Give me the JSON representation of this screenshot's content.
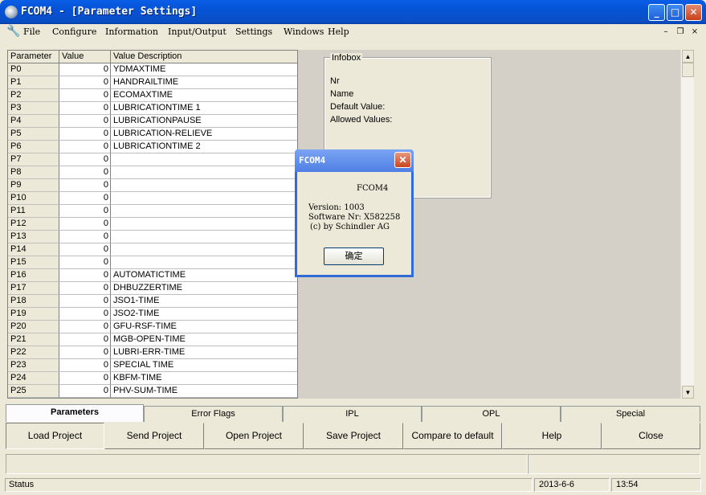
{
  "window": {
    "title": "FCOM4 - [Parameter Settings]",
    "min_glyph": "_",
    "max_glyph": "□",
    "close_glyph": "✕"
  },
  "menu": {
    "icon_glyph": "🔧",
    "items": [
      "File",
      "Configure",
      "Information",
      "Input/Output",
      "Settings",
      "Windows",
      "Help"
    ],
    "mdi_min": "–",
    "mdi_restore": "❐",
    "mdi_close": "×"
  },
  "grid": {
    "headers": [
      "Parameter",
      "Value",
      "Value Description"
    ],
    "rows": [
      [
        "P0",
        "0",
        "YDMAXTIME"
      ],
      [
        "P1",
        "0",
        "HANDRAILTIME"
      ],
      [
        "P2",
        "0",
        "ECOMAXTIME"
      ],
      [
        "P3",
        "0",
        "LUBRICATIONTIME 1"
      ],
      [
        "P4",
        "0",
        "LUBRICATIONPAUSE"
      ],
      [
        "P5",
        "0",
        "LUBRICATION-RELIEVE"
      ],
      [
        "P6",
        "0",
        "LUBRICATIONTIME 2"
      ],
      [
        "P7",
        "0",
        ""
      ],
      [
        "P8",
        "0",
        ""
      ],
      [
        "P9",
        "0",
        ""
      ],
      [
        "P10",
        "0",
        ""
      ],
      [
        "P11",
        "0",
        ""
      ],
      [
        "P12",
        "0",
        ""
      ],
      [
        "P13",
        "0",
        ""
      ],
      [
        "P14",
        "0",
        ""
      ],
      [
        "P15",
        "0",
        ""
      ],
      [
        "P16",
        "0",
        "AUTOMATICTIME"
      ],
      [
        "P17",
        "0",
        "DHBUZZERTIME"
      ],
      [
        "P18",
        "0",
        "JSO1-TIME"
      ],
      [
        "P19",
        "0",
        "JSO2-TIME"
      ],
      [
        "P20",
        "0",
        "GFU-RSF-TIME"
      ],
      [
        "P21",
        "0",
        "MGB-OPEN-TIME"
      ],
      [
        "P22",
        "0",
        "LUBRI-ERR-TIME"
      ],
      [
        "P23",
        "0",
        "SPECIAL TIME"
      ],
      [
        "P24",
        "0",
        "KBFM-TIME"
      ],
      [
        "P25",
        "0",
        "PHV-SUM-TIME"
      ]
    ]
  },
  "infobox": {
    "legend": "Infobox",
    "lines": [
      "Nr",
      "Name",
      "Default Value:",
      "Allowed Values:"
    ]
  },
  "scrollbar": {
    "up": "▲",
    "down": "▼"
  },
  "dialog": {
    "title": "FCOM4",
    "close_glyph": "✕",
    "app_name": "FCOM4",
    "version": "Version: 1003",
    "software_nr": "Software Nr: X582258",
    "copyright": "(c) by Schindler AG",
    "ok_label": "确定"
  },
  "tabs": [
    "Parameters",
    "Error Flags",
    "IPL",
    "OPL",
    "Special"
  ],
  "actions": [
    "Load Project",
    "Send Project",
    "Open Project",
    "Save Project",
    "Compare to default",
    "Help",
    "Close"
  ],
  "statusbar": {
    "status": "Status",
    "date": "2013-6-6",
    "time": "13:54"
  }
}
